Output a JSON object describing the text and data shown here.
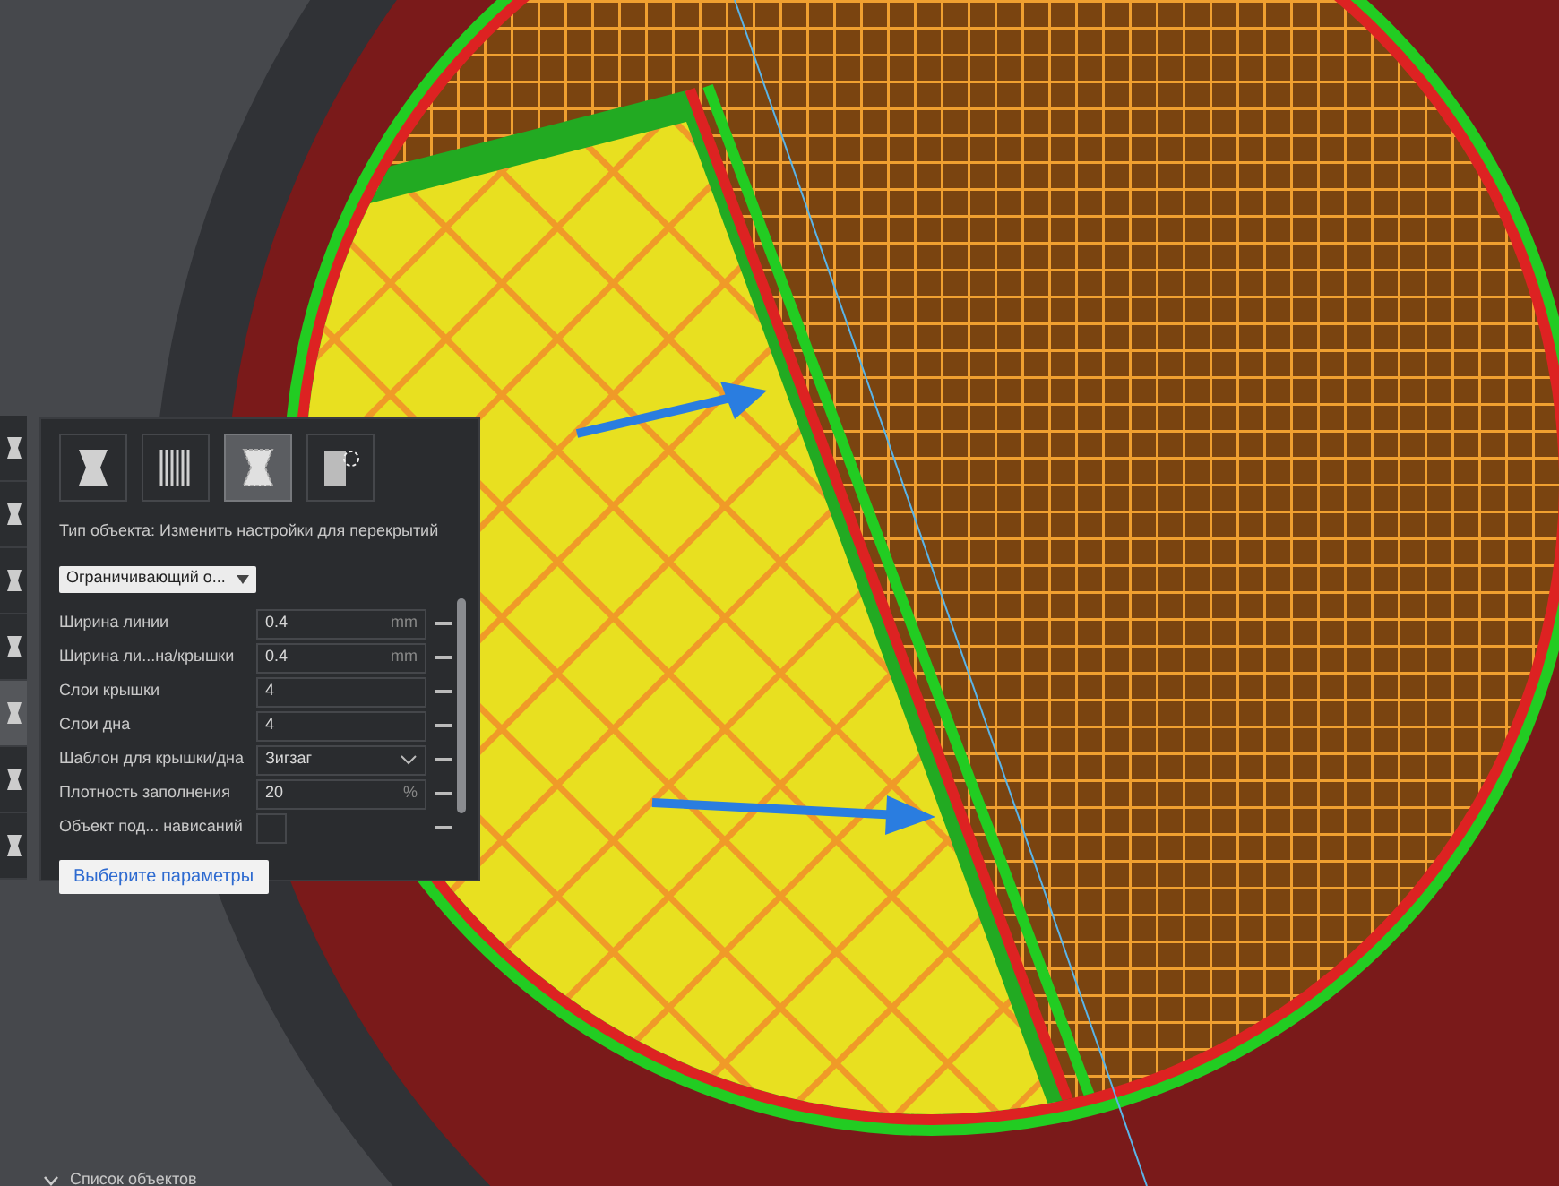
{
  "toolbar": [
    {
      "selected": false
    },
    {
      "selected": false
    },
    {
      "selected": false
    },
    {
      "selected": false
    },
    {
      "selected": true
    },
    {
      "selected": false
    },
    {
      "selected": false
    }
  ],
  "mesh_types": [
    {
      "selected": false
    },
    {
      "selected": false
    },
    {
      "selected": true
    },
    {
      "selected": false
    }
  ],
  "object_type_label": "Тип объекта: Изменить настройки для перекрытий",
  "dropdown": {
    "value": "Ограничивающий о..."
  },
  "settings": [
    {
      "kind": "field",
      "label": "Ширина линии",
      "value": "0.4",
      "unit": "mm"
    },
    {
      "kind": "field",
      "label": "Ширина ли...на/крышки",
      "value": "0.4",
      "unit": "mm"
    },
    {
      "kind": "field",
      "label": "Слои крышки",
      "value": "4"
    },
    {
      "kind": "field",
      "label": "Слои дна",
      "value": "4"
    },
    {
      "kind": "dropdown",
      "label": "Шаблон для крышки/дна",
      "value": "Зигзаг"
    },
    {
      "kind": "field",
      "label": "Плотность заполнения",
      "value": "20",
      "unit": "%"
    },
    {
      "kind": "checkbox",
      "label": "Объект под... нависаний",
      "checked": false
    }
  ],
  "select_button": "Выберите параметры",
  "object_list": {
    "label": "Список объектов",
    "expanded": false
  }
}
